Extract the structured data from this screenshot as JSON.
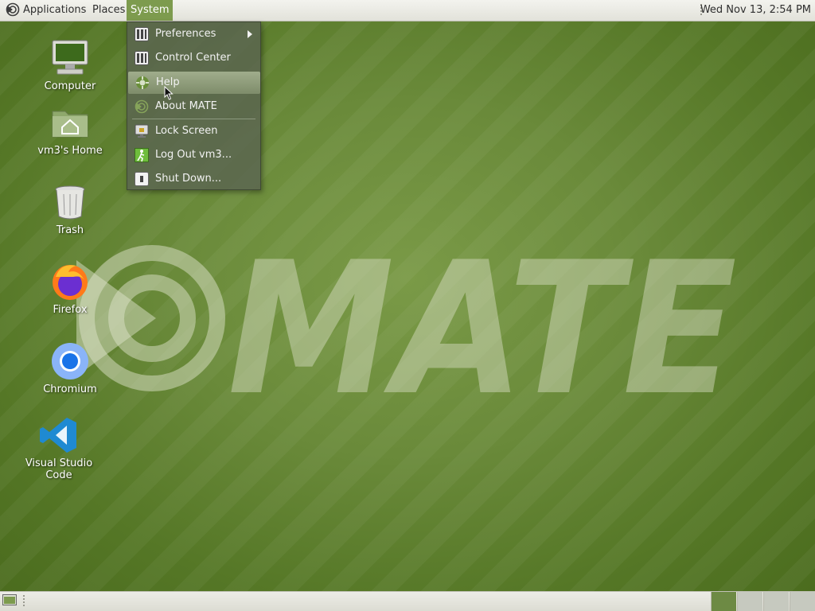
{
  "top_panel": {
    "applications": "Applications",
    "places": "Places",
    "system": "System",
    "clock": "Wed Nov 13,  2:54 PM"
  },
  "system_menu": {
    "items": [
      {
        "label": "Preferences",
        "icon": "preferences-icon",
        "has_submenu": true
      },
      {
        "label": "Control Center",
        "icon": "control-center-icon"
      },
      {
        "label": "Help",
        "icon": "help-icon",
        "highlighted": true
      },
      {
        "label": "About MATE",
        "icon": "mate-logo-icon"
      },
      {
        "label": "Lock Screen",
        "icon": "lock-screen-icon"
      },
      {
        "label": "Log Out vm3...",
        "icon": "logout-icon"
      },
      {
        "label": "Shut Down...",
        "icon": "shutdown-icon"
      }
    ]
  },
  "desktop": {
    "icons": [
      {
        "label": "Computer",
        "icon": "computer-icon"
      },
      {
        "label": "vm3's Home",
        "icon": "home-folder-icon"
      },
      {
        "label": "Trash",
        "icon": "trash-icon"
      },
      {
        "label": "Firefox",
        "icon": "firefox-icon"
      },
      {
        "label": "Chromium",
        "icon": "chromium-icon"
      },
      {
        "label": "Visual Studio Code",
        "icon": "vscode-icon"
      }
    ],
    "wallpaper_text": "MATE"
  },
  "bottom_panel": {
    "workspaces": 4,
    "active_workspace": 1
  },
  "colors": {
    "accent": "#7d9b4e",
    "wallpaper": "#6a8a3a",
    "menu_bg": "#5a6450"
  }
}
